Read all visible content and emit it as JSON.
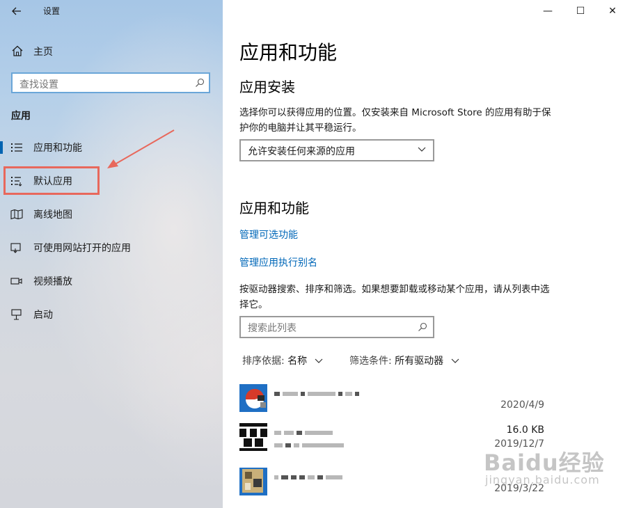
{
  "window": {
    "title": "设置",
    "back_icon": "arrow-left-icon",
    "minimize": "—",
    "maximize": "☐",
    "close": "✕"
  },
  "sidebar": {
    "home_label": "主页",
    "search_placeholder": "查找设置",
    "section_label": "应用",
    "items": [
      {
        "label": "应用和功能",
        "icon": "apps-list-icon",
        "selected": true
      },
      {
        "label": "默认应用",
        "icon": "default-apps-icon",
        "selected": false
      },
      {
        "label": "离线地图",
        "icon": "map-icon",
        "selected": false
      },
      {
        "label": "可使用网站打开的应用",
        "icon": "website-apps-icon",
        "selected": false
      },
      {
        "label": "视频播放",
        "icon": "video-icon",
        "selected": false
      },
      {
        "label": "启动",
        "icon": "startup-icon",
        "selected": false
      }
    ]
  },
  "main": {
    "title": "应用和功能",
    "install": {
      "heading": "应用安装",
      "description": "选择你可以获得应用的位置。仅安装来自 Microsoft Store 的应用有助于保护你的电脑并让其平稳运行。",
      "dropdown_value": "允许安装任何来源的应用"
    },
    "apps": {
      "heading": "应用和功能",
      "link_optional": "管理可选功能",
      "link_alias": "管理应用执行别名",
      "description": "按驱动器搜索、排序和筛选。如果想要卸载或移动某个应用，请从列表中选择它。",
      "search_placeholder": "搜索此列表",
      "sort_key": "排序依据:",
      "sort_value": "名称",
      "filter_key": "筛选条件:",
      "filter_value": "所有驱动器",
      "list": [
        {
          "size": "",
          "date": "2020/4/9"
        },
        {
          "size": "16.0 KB",
          "date": "2019/12/7"
        },
        {
          "size": "",
          "date": "2019/3/22"
        }
      ]
    }
  },
  "watermark": {
    "brand": "Baidu经验",
    "url": "jingyan.baidu.com"
  },
  "colors": {
    "accent": "#0063b1",
    "link": "#0067b8",
    "annotation": "#e8685c"
  }
}
